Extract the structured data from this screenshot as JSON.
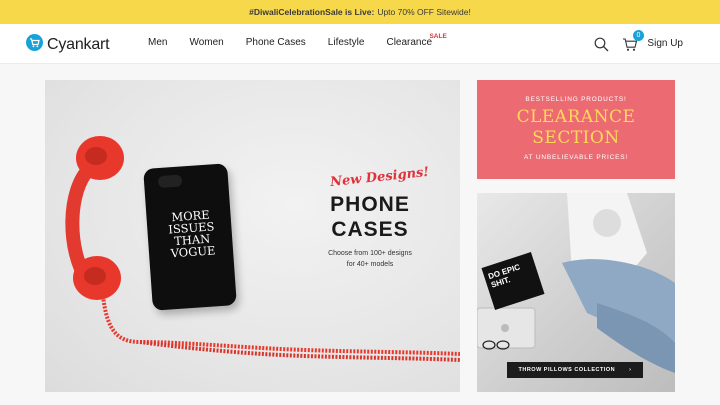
{
  "promo": {
    "lead": "#DiwaliCelebrationSale is Live:",
    "text": "Upto 70% OFF Sitewide!"
  },
  "header": {
    "logo": "Cyankart",
    "nav": [
      "Men",
      "Women",
      "Phone Cases",
      "Lifestyle",
      "Clearance"
    ],
    "sale_tag": "SALE",
    "cart_count": "0",
    "signup": "Sign Up"
  },
  "hero": {
    "tagline": "New Designs!",
    "title_line1": "PHONE",
    "title_line2": "CASES",
    "sub_line1": "Choose from 100+ designs",
    "sub_line2": "for 40+ models",
    "phone_case_text": "MORE ISSUES THAN VOGUE"
  },
  "clearance_banner": {
    "top": "BESTSELLING PRODUCTS!",
    "title_line1": "CLEARANCE",
    "title_line2": "SECTION",
    "bottom": "AT UNBELIEVABLE PRICES!"
  },
  "pillows_banner": {
    "pillow_text": "DO EPIC SHIT.",
    "cta": "THROW PILLOWS COLLECTION",
    "cta_arrow": "›"
  },
  "colors": {
    "promo": "#f7d84a",
    "accent": "#16a3d9",
    "sale": "#e0323a",
    "clearance_bg": "#ec6b73",
    "clearance_title": "#ffd95a"
  },
  "icons": {
    "logo": "cart-logo-icon",
    "search": "search-icon",
    "cart": "cart-icon"
  }
}
